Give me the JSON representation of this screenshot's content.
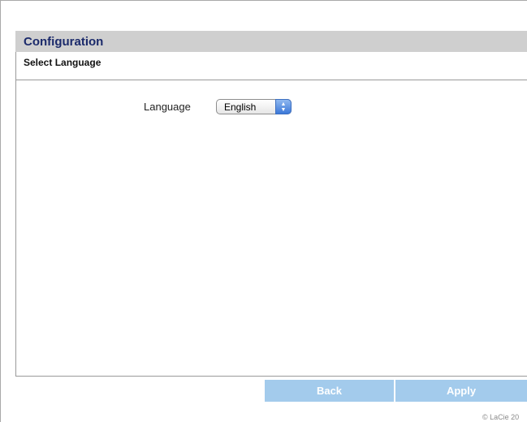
{
  "header": {
    "title": "Configuration"
  },
  "section": {
    "title": "Select Language"
  },
  "language": {
    "label": "Language",
    "selected": "English",
    "arrows_icon": "updown-arrows-icon"
  },
  "actions": {
    "back_label": "Back",
    "apply_label": "Apply"
  },
  "footer": {
    "copyright": "© LaCie 20"
  },
  "colors": {
    "header_bg": "#cfcfcf",
    "header_text": "#1b2a6b",
    "button_bg": "#a3cbec",
    "button_text": "#ffffff",
    "select_arrow_bg": "#3c78d8"
  }
}
